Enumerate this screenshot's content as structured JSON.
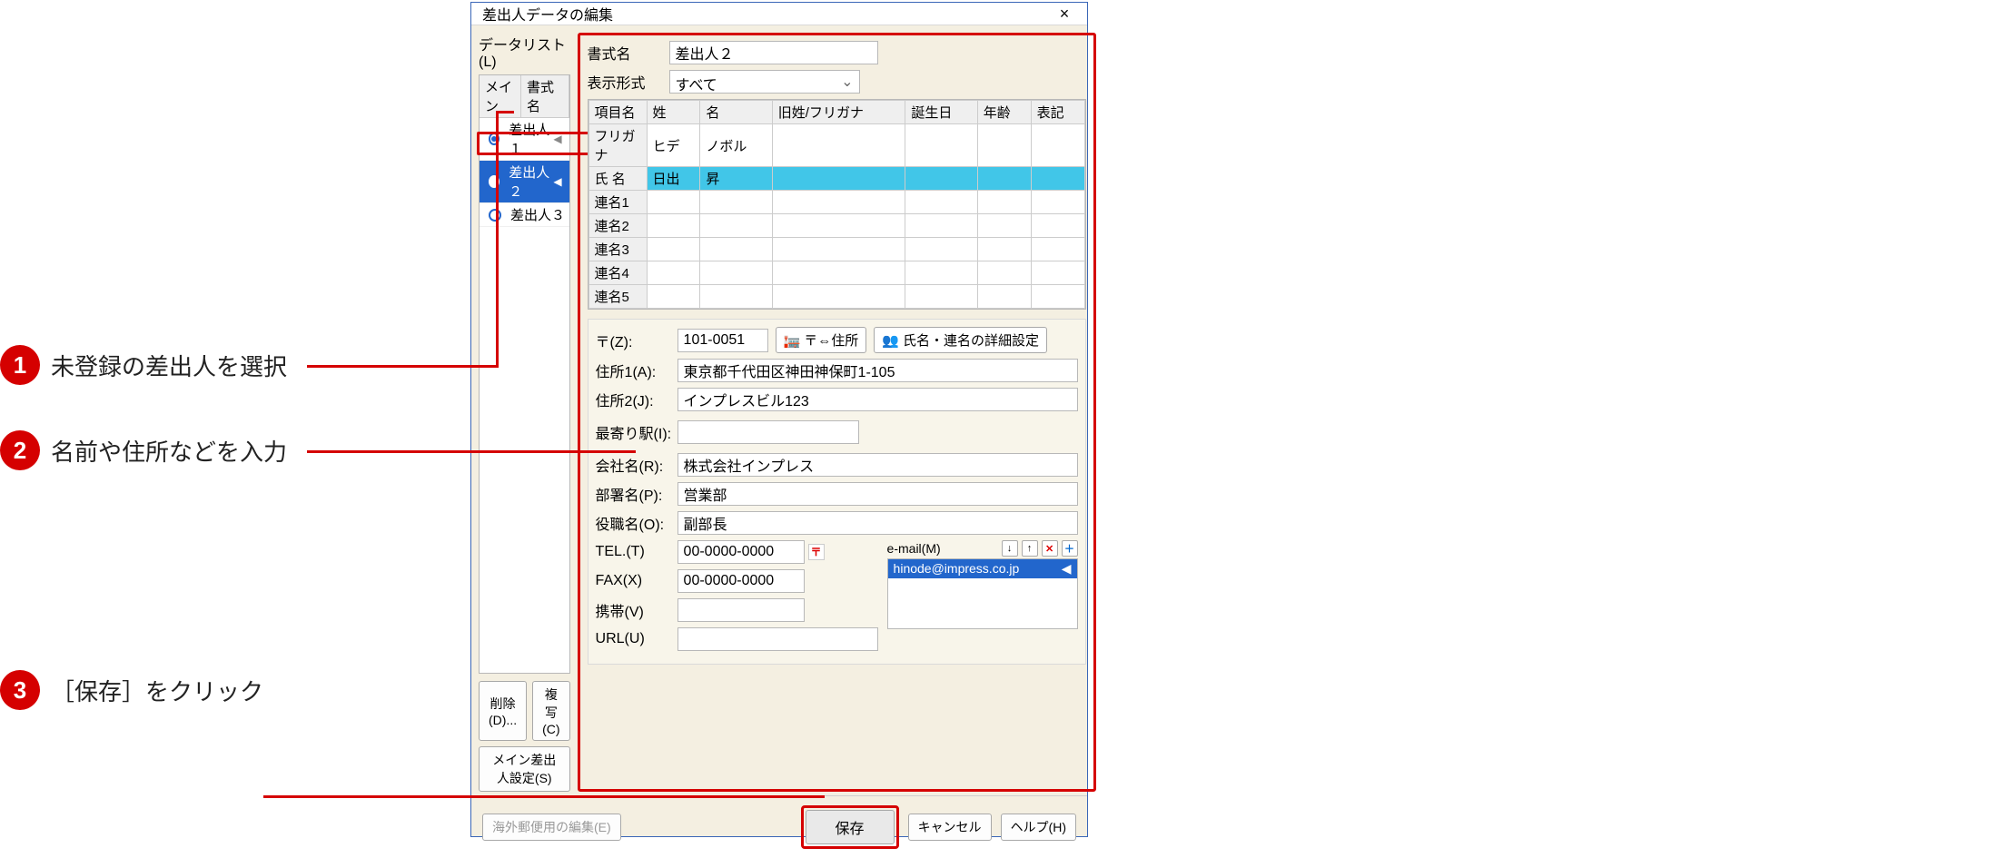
{
  "callouts": {
    "c1": {
      "num": "1",
      "text": "未登録の差出人を選択"
    },
    "c2": {
      "num": "2",
      "text": "名前や住所などを入力"
    },
    "c3": {
      "num": "3",
      "text": "［保存］をクリック"
    }
  },
  "dialog": {
    "title": "差出人データの編集",
    "close": "×"
  },
  "left": {
    "label": "データリスト(L)",
    "headers": {
      "main": "メイン",
      "name": "書式名"
    },
    "rows": [
      {
        "name": "差出人１",
        "selected": false,
        "filled": true
      },
      {
        "name": "差出人２",
        "selected": true,
        "filled": false
      },
      {
        "name": "差出人３",
        "selected": false,
        "filled": false
      }
    ],
    "btnDelete": "削除(D)...",
    "btnCopy": "複写(C)",
    "btnMain": "メイン差出人設定(S)"
  },
  "form": {
    "labelFormatName": "書式名",
    "valFormatName": "差出人２",
    "labelDisplay": "表示形式",
    "valDisplay": "すべて",
    "gridHeaders": {
      "item": "項目名",
      "sei": "姓",
      "mei": "名",
      "oldkana": "旧姓/フリガナ",
      "bday": "誕生日",
      "age": "年齢",
      "notation": "表記"
    },
    "gridRows": [
      {
        "label": "フリガナ",
        "sei": "ヒデ",
        "mei": "ノボル"
      },
      {
        "label": "氏 名",
        "sei": "日出",
        "mei": "昇"
      },
      {
        "label": "連名1"
      },
      {
        "label": "連名2"
      },
      {
        "label": "連名3"
      },
      {
        "label": "連名4"
      },
      {
        "label": "連名5"
      }
    ],
    "zipLabel": "〒(Z):",
    "zipVal": "101-0051",
    "btnZipAddr": "〒⇔住所",
    "btnNameDetail": "氏名・連名の詳細設定",
    "addr1Label": "住所1(A):",
    "addr1Val": "東京都千代田区神田神保町1-105",
    "addr2Label": "住所2(J):",
    "addr2Val": "インプレスビル123",
    "stationLabel": "最寄り駅(I):",
    "stationVal": "",
    "companyLabel": "会社名(R):",
    "companyVal": "株式会社インプレス",
    "deptLabel": "部署名(P):",
    "deptVal": "営業部",
    "roleLabel": "役職名(O):",
    "roleVal": "副部長",
    "telLabel": "TEL.(T)",
    "telVal": "00-0000-0000",
    "faxLabel": "FAX(X)",
    "faxVal": "00-0000-0000",
    "mobileLabel": "携帯(V)",
    "mobileVal": "",
    "urlLabel": "URL(U)",
    "urlVal": "",
    "emailLabel": "e-mail(M)",
    "emailVal": "hinode@impress.co.jp"
  },
  "bottom": {
    "overseas": "海外郵便用の編集(E)",
    "save": "保存",
    "cancel": "キャンセル",
    "help": "ヘルプ(H)"
  }
}
